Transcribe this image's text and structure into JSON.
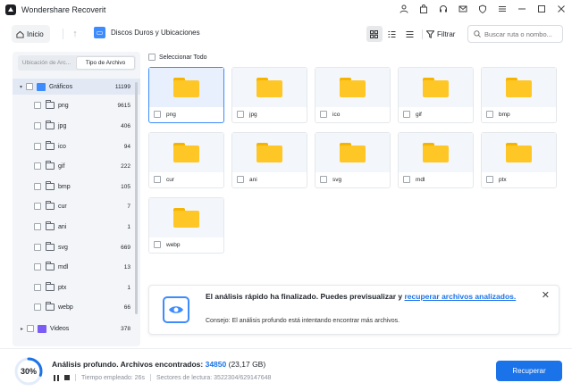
{
  "app": {
    "title": "Wondershare Recoverit"
  },
  "toolbar": {
    "home_label": "Inicio",
    "breadcrumb": "Discos Duros y Ubicaciones",
    "filter_label": "Filtrar",
    "search_placeholder": "Buscar ruta o nombo..."
  },
  "sidebar": {
    "tabs": [
      {
        "label": "Ubicación de Arc..."
      },
      {
        "label": "Tipo de Archivo"
      }
    ],
    "tree": [
      {
        "label": "Gráficos",
        "count": "11199"
      },
      {
        "label": "png",
        "count": "9615"
      },
      {
        "label": "jpg",
        "count": "406"
      },
      {
        "label": "ico",
        "count": "94"
      },
      {
        "label": "gif",
        "count": "222"
      },
      {
        "label": "bmp",
        "count": "105"
      },
      {
        "label": "cur",
        "count": "7"
      },
      {
        "label": "ani",
        "count": "1"
      },
      {
        "label": "svg",
        "count": "669"
      },
      {
        "label": "mdl",
        "count": "13"
      },
      {
        "label": "ptx",
        "count": "1"
      },
      {
        "label": "webp",
        "count": "66"
      },
      {
        "label": "Videos",
        "count": "378"
      }
    ]
  },
  "grid": {
    "select_all": "Seleccionar Todo",
    "folders": [
      "png",
      "jpg",
      "ico",
      "gif",
      "bmp",
      "cur",
      "ani",
      "svg",
      "mdl",
      "ptx",
      "webp"
    ]
  },
  "notification": {
    "title": "El análisis rápido ha finalizado. Puedes previsualizar y ",
    "link": "recuperar archivos analizados.",
    "subtitle": "Consejo: El análisis profundo está intentando encontrar más archivos."
  },
  "status": {
    "progress_pct": 30,
    "progress_label": "30%",
    "text": "Análisis profundo. Archivos encontrados: ",
    "found": "34850",
    "size": "(23,17 GB)",
    "elapsed": "Tiempo empleado: 26s",
    "sectors": "Sectores de lectura: 3522304/629147648",
    "recover_label": "Recuperar"
  },
  "colors": {
    "accent": "#1a73e8",
    "folder": "#ffc726"
  }
}
